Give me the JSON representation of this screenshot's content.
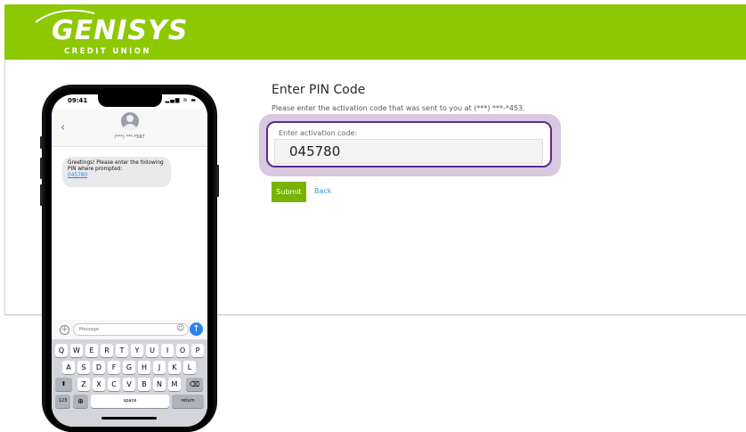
{
  "brand": {
    "name": "GENISYS",
    "subtitle": "CREDIT UNION",
    "header_color": "#8dc800"
  },
  "pin_page": {
    "heading": "Enter PIN Code",
    "instructions": "Please enter the activation code that was sent to you at (***) ***-*453.",
    "field_label": "Enter activation code:",
    "code_value": "045780",
    "submit_label": "Submit",
    "back_label": "Back",
    "highlight_color": "#5c2a8a"
  },
  "phone": {
    "time": "09:41",
    "status_icons": "▂▄▆ ≋ ▬",
    "back_icon": "chevron-left-icon",
    "contact_number": "(***) ***-*597",
    "message_text": "Greetings! Please enter the following PIN where prompted:",
    "message_pin": "045780",
    "input_placeholder": "Message",
    "keyboard": {
      "row1": [
        "Q",
        "W",
        "E",
        "R",
        "T",
        "Y",
        "U",
        "I",
        "O",
        "P"
      ],
      "row2": [
        "A",
        "S",
        "D",
        "F",
        "G",
        "H",
        "J",
        "K",
        "L"
      ],
      "row3": [
        "Z",
        "X",
        "C",
        "V",
        "B",
        "N",
        "M"
      ],
      "shift": "⬆",
      "delete": "⌫",
      "numbers": "123",
      "globe": "⊕",
      "space": "space",
      "return": "return"
    }
  }
}
